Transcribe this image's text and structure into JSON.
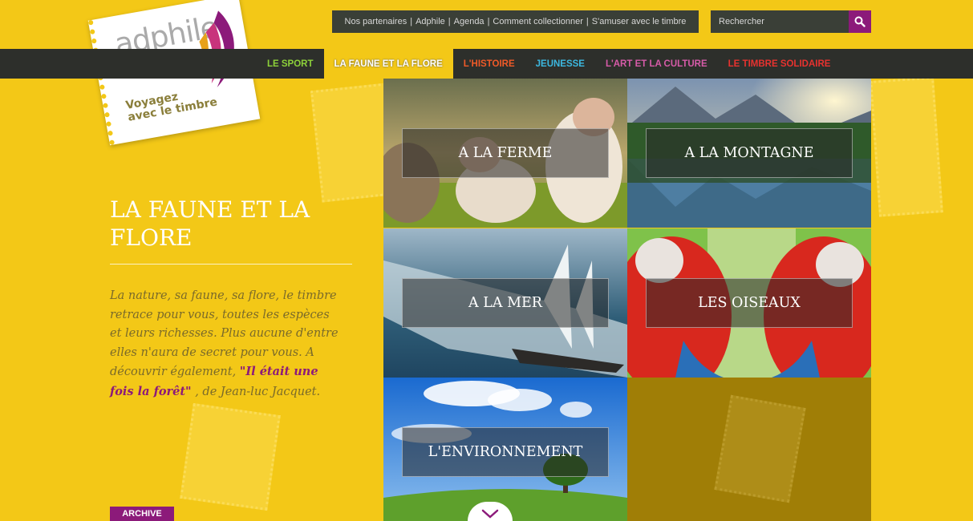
{
  "logo": {
    "brand": "adphile",
    "tagline_line1": "Voyagez",
    "tagline_line2": "avec le timbre"
  },
  "util_links": [
    "Nos partenaires",
    "Adphile",
    "Agenda",
    "Comment collectionner",
    "S'amuser avec le timbre"
  ],
  "search": {
    "placeholder": "Rechercher",
    "icon": "search-icon"
  },
  "nav": [
    {
      "label": "LE SPORT",
      "color": "#8dd13a"
    },
    {
      "label": "LA FAUNE ET LA FLORE",
      "color": "#ffffff",
      "active": true
    },
    {
      "label": "L'HISTOIRE",
      "color": "#f05a28"
    },
    {
      "label": "JEUNESSE",
      "color": "#3cb8e0"
    },
    {
      "label": "L'ART ET LA CULTURE",
      "color": "#d65ba8"
    },
    {
      "label": "LE TIMBRE SOLIDAIRE",
      "color": "#e8322f"
    }
  ],
  "section": {
    "title": "LA FAUNE ET LA FLORE",
    "description_text": "La nature, sa faune, sa flore, le timbre retrace pour vous, toutes les espèces et leurs richesses. Plus aucune d'entre elles n'aura de secret pour vous. A découvrir également, ",
    "description_link": "\"Il était une fois la forêt\"",
    "description_after": " , de Jean-luc Jacquet.",
    "archive_label": "ARCHIVE"
  },
  "tiles": [
    {
      "label": "A LA FERME"
    },
    {
      "label": "A LA MONTAGNE"
    },
    {
      "label": "A LA MER"
    },
    {
      "label": "LES OISEAUX"
    },
    {
      "label": "L'ENVIRONNEMENT"
    }
  ],
  "colors": {
    "background": "#f3c817",
    "nav_bar": "#2d2f2b",
    "accent_purple": "#8c1a7a"
  }
}
